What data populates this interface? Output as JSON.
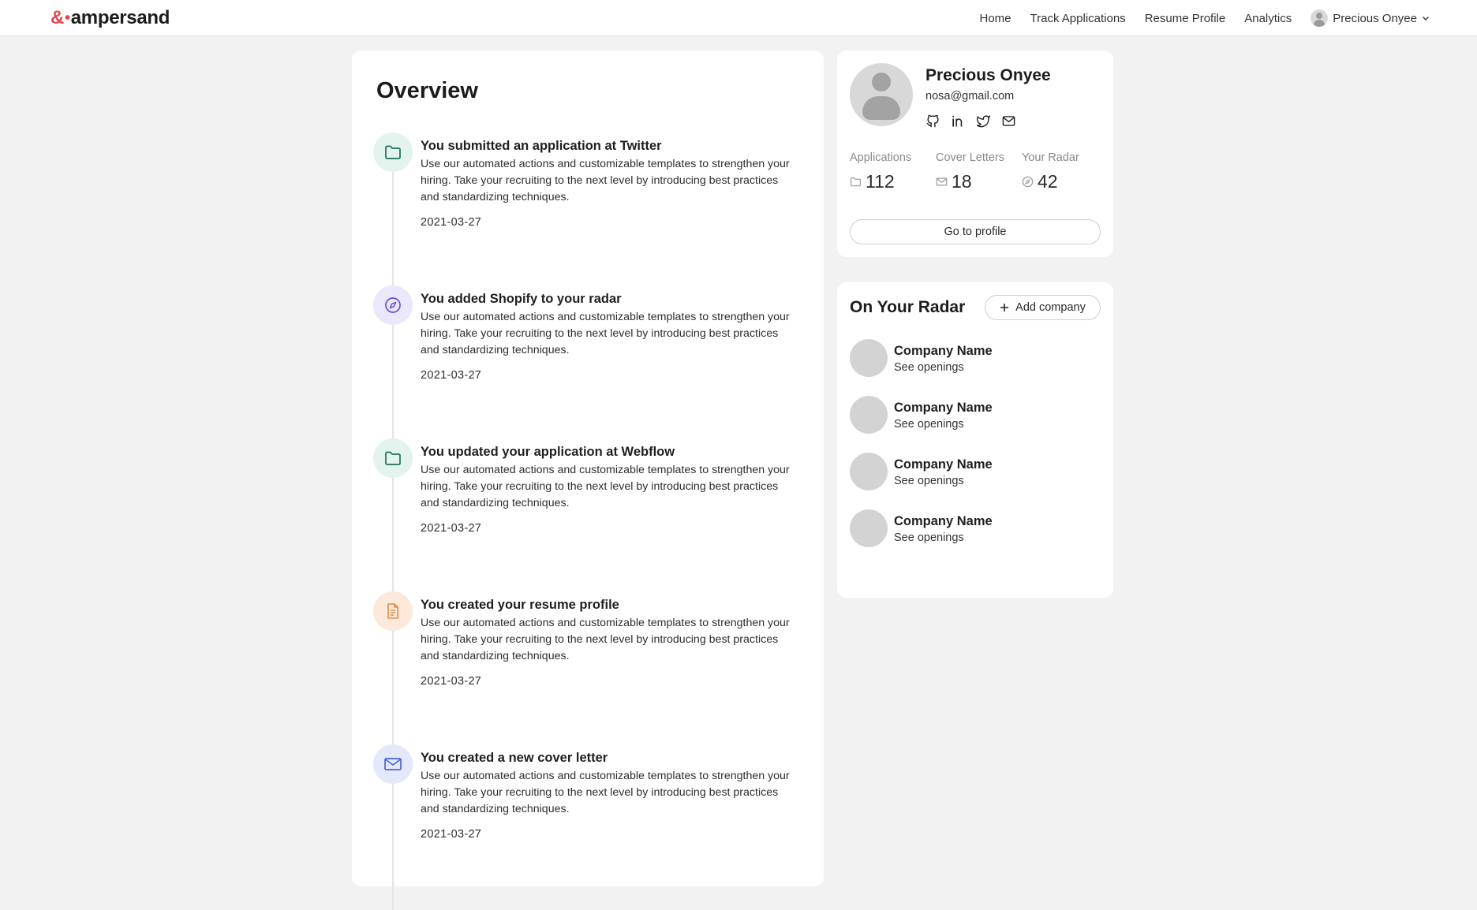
{
  "header": {
    "logo_symbol": "&",
    "logo_text": "ampersand",
    "nav": [
      "Home",
      "Track Applications",
      "Resume Profile",
      "Analytics"
    ],
    "user_name": "Precious Onyee"
  },
  "overview": {
    "title": "Overview",
    "items": [
      {
        "title": "You submitted an application at Twitter",
        "desc": "Use our automated actions and customizable templates to strengthen your hiring. Take your recruiting to the next level by introducing best practices and standardizing techniques.",
        "date": "2021-03-27",
        "icon": "folder-icon"
      },
      {
        "title": "You added Shopify to your radar",
        "desc": "Use our automated actions and customizable templates to strengthen your hiring. Take your recruiting to the next level by introducing best practices and standardizing techniques.",
        "date": "2021-03-27",
        "icon": "compass-icon"
      },
      {
        "title": "You updated your application at Webflow",
        "desc": "Use our automated actions and customizable templates to strengthen your hiring. Take your recruiting to the next level by introducing best practices and standardizing techniques.",
        "date": "2021-03-27",
        "icon": "folder-icon"
      },
      {
        "title": "You created your resume profile",
        "desc": "Use our automated actions and customizable templates to strengthen your hiring. Take your recruiting to the next level by introducing best practices and standardizing techniques.",
        "date": "2021-03-27",
        "icon": "document-icon"
      },
      {
        "title": "You created a new cover letter",
        "desc": "Use our automated actions and customizable templates to strengthen your hiring. Take your recruiting to the next level by introducing best practices and standardizing techniques.",
        "date": "2021-03-27",
        "icon": "mail-icon"
      }
    ]
  },
  "profile": {
    "name": "Precious Onyee",
    "email": "nosa@gmail.com",
    "socials": [
      "github-icon",
      "linkedin-icon",
      "twitter-icon",
      "mail-icon"
    ],
    "stats": [
      {
        "label": "Applications",
        "value": "112",
        "icon": "folder-icon"
      },
      {
        "label": "Cover Letters",
        "value": "18",
        "icon": "mail-icon"
      },
      {
        "label": "Your Radar",
        "value": "42",
        "icon": "compass-icon"
      }
    ],
    "button": "Go to profile"
  },
  "radar": {
    "title": "On Your Radar",
    "add_button": "Add company",
    "companies": [
      {
        "name": "Company Name",
        "link": "See openings"
      },
      {
        "name": "Company Name",
        "link": "See openings"
      },
      {
        "name": "Company Name",
        "link": "See openings"
      },
      {
        "name": "Company Name",
        "link": "See openings"
      }
    ]
  },
  "colors": {
    "brand": "#e5484d",
    "folder_badge": "#e3f4ef",
    "folder_icon": "#1f6f5c",
    "compass_badge": "#ece8fb",
    "compass_icon": "#6b4fd8",
    "document_badge": "#fde9dc",
    "document_icon": "#e08a4a",
    "mail_badge": "#e3e8fb",
    "mail_icon": "#4a63d8"
  }
}
